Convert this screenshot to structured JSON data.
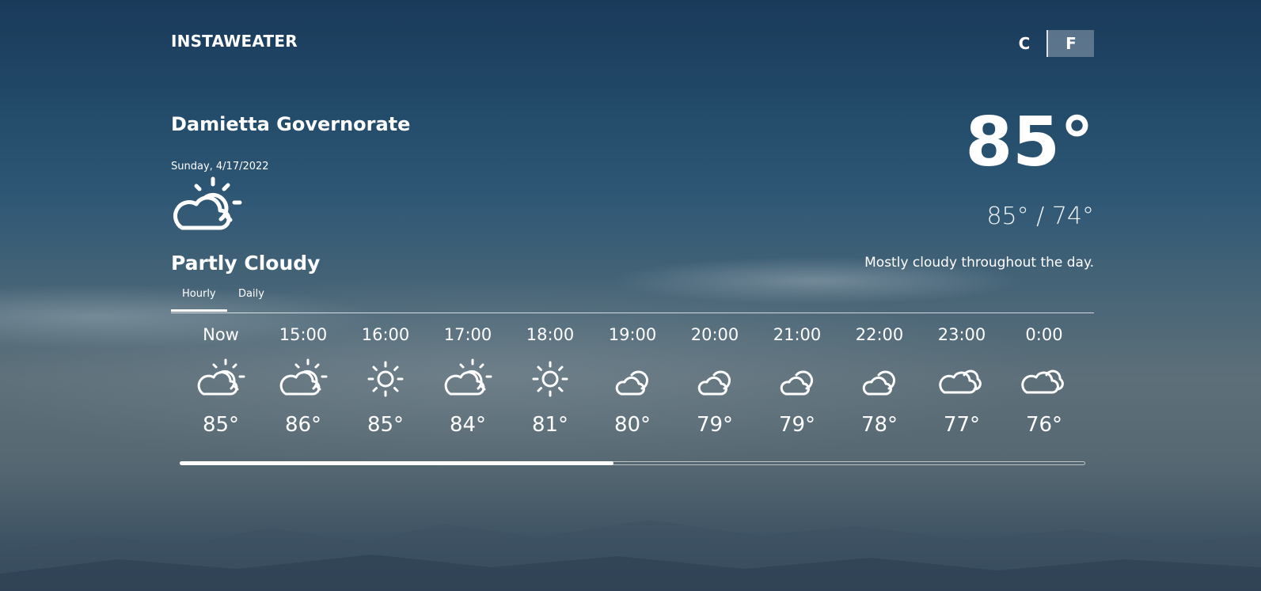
{
  "app": {
    "brand": "INSTAWEATER"
  },
  "units": {
    "celsius": "C",
    "fahrenheit": "F",
    "selected": "F"
  },
  "current": {
    "location": "Damietta Governorate",
    "date": "Sunday, 4/17/2022",
    "icon": "partly-cloudy-day-icon",
    "condition": "Partly Cloudy",
    "temperature": "85°",
    "range": "85° / 74°",
    "summary": "Mostly cloudy throughout the day."
  },
  "tabs": [
    {
      "label": "Hourly",
      "active": true
    },
    {
      "label": "Daily",
      "active": false
    }
  ],
  "hourly": [
    {
      "time": "Now",
      "icon": "partly-cloudy-day-icon",
      "temp": "85°"
    },
    {
      "time": "15:00",
      "icon": "partly-cloudy-day-icon",
      "temp": "86°"
    },
    {
      "time": "16:00",
      "icon": "clear-day-icon",
      "temp": "85°"
    },
    {
      "time": "17:00",
      "icon": "partly-cloudy-day-icon",
      "temp": "84°"
    },
    {
      "time": "18:00",
      "icon": "clear-day-icon",
      "temp": "81°"
    },
    {
      "time": "19:00",
      "icon": "partly-cloudy-night-icon",
      "temp": "80°"
    },
    {
      "time": "20:00",
      "icon": "partly-cloudy-night-icon",
      "temp": "79°"
    },
    {
      "time": "21:00",
      "icon": "partly-cloudy-night-icon",
      "temp": "79°"
    },
    {
      "time": "22:00",
      "icon": "partly-cloudy-night-icon",
      "temp": "78°"
    },
    {
      "time": "23:00",
      "icon": "cloudy-icon",
      "temp": "77°"
    },
    {
      "time": "0:00",
      "icon": "cloudy-icon",
      "temp": "76°"
    }
  ],
  "scroll": {
    "position_fraction": 0.48
  },
  "colors": {
    "text": "#ffffff",
    "sky_top": "#1a3a5a",
    "sky_mid": "#486577"
  }
}
